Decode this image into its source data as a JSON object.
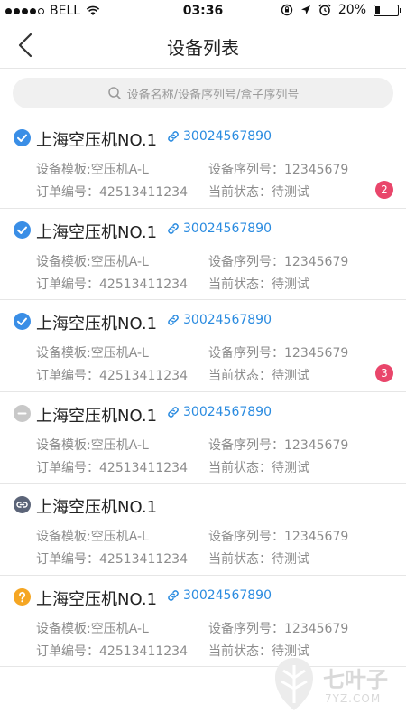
{
  "status_bar": {
    "carrier": "BELL",
    "time": "03:36",
    "battery": "20%",
    "battery_level": 0.2
  },
  "nav": {
    "title": "设备列表",
    "back_icon": "chevron-left-icon"
  },
  "search": {
    "placeholder": "设备名称/设备序列号/盒子序列号",
    "icon": "search-icon"
  },
  "devices": [
    {
      "name": "上海空压机NO.1",
      "status_icon": "check-circle-icon",
      "status_color": "#3a8ee6",
      "serial_link": "30024567890",
      "template": "设备模板:空压机A-L",
      "serial": "设备序列号：12345679",
      "order": "订单编号：42513411234",
      "state": "当前状态：待测试",
      "badge": "2"
    },
    {
      "name": "上海空压机NO.1",
      "status_icon": "check-circle-icon",
      "status_color": "#3a8ee6",
      "serial_link": "30024567890",
      "template": "设备模板:空压机A-L",
      "serial": "设备序列号：12345679",
      "order": "订单编号：42513411234",
      "state": "当前状态：待测试",
      "badge": ""
    },
    {
      "name": "上海空压机NO.1",
      "status_icon": "check-circle-icon",
      "status_color": "#3a8ee6",
      "serial_link": "30024567890",
      "template": "设备模板:空压机A-L",
      "serial": "设备序列号：12345679",
      "order": "订单编号：42513411234",
      "state": "当前状态：待测试",
      "badge": "3"
    },
    {
      "name": "上海空压机NO.1",
      "status_icon": "minus-circle-icon",
      "status_color": "#c8c8c8",
      "serial_link": "30024567890",
      "template": "设备模板:空压机A-L",
      "serial": "设备序列号：12345679",
      "order": "订单编号：42513411234",
      "state": "当前状态：待测试",
      "badge": ""
    },
    {
      "name": "上海空压机NO.1",
      "status_icon": "unlink-circle-icon",
      "status_color": "#5b6478",
      "serial_link": "",
      "template": "设备模板:空压机A-L",
      "serial": "设备序列号：12345679",
      "order": "订单编号：42513411234",
      "state": "当前状态：待测试",
      "badge": ""
    },
    {
      "name": "上海空压机NO.1",
      "status_icon": "question-circle-icon",
      "status_color": "#f5a623",
      "serial_link": "30024567890",
      "template": "设备模板:空压机A-L",
      "serial": "设备序列号：12345679",
      "order": "订单编号：42513411234",
      "state": "当前状态：待测试",
      "badge": ""
    }
  ],
  "watermark": {
    "name": "七叶子",
    "url": "7YZ.COM"
  },
  "colors": {
    "link": "#2a8be0",
    "badge": "#e9466b",
    "divider": "#e6e6e6"
  }
}
